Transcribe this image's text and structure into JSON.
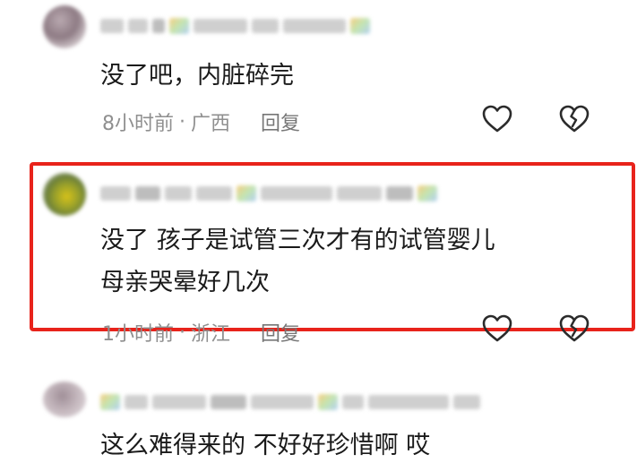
{
  "comments": [
    {
      "text_lines": [
        "没了吧，内脏碎完"
      ],
      "time": "8小时前",
      "location": "广西",
      "reply_label": "回复"
    },
    {
      "text_lines": [
        "没了 孩子是试管三次才有的试管婴儿",
        "母亲哭晕好几次"
      ],
      "time": "1小时前",
      "location": "浙江",
      "reply_label": "回复",
      "highlighted": true
    },
    {
      "text_lines": [
        "这么难得来的 不好好珍惜啊 哎"
      ]
    }
  ],
  "meta_separator": "·",
  "icons": {
    "like": "heart-outline-icon",
    "dislike": "broken-heart-outline-icon"
  },
  "colors": {
    "text": "#1a1a1a",
    "meta": "#8f8f8f",
    "highlight_border": "#e8231b",
    "icon_stroke": "#2b2b2b"
  }
}
